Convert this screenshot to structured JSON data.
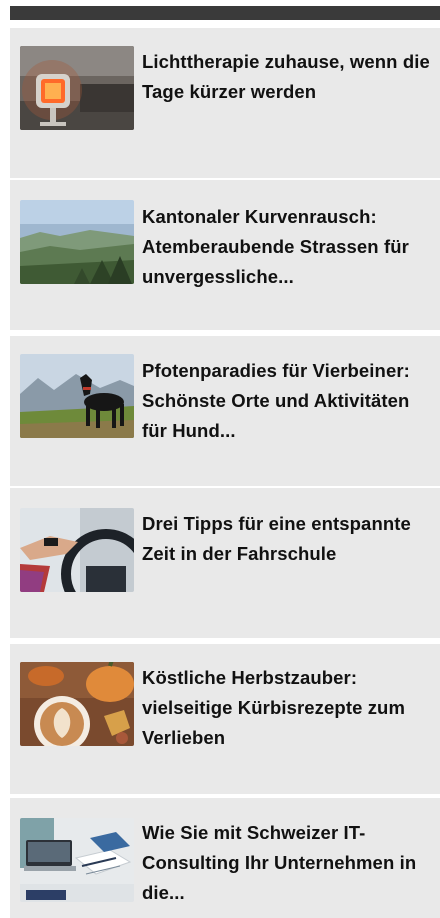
{
  "articles": [
    {
      "title": "Lichttherapie zuhause, wenn die Tage kürzer werden",
      "image": "infrared-lamp-photo"
    },
    {
      "title": "Kantonaler Kurvenrausch: Atemberaubende Strassen für unvergessliche...",
      "image": "alpine-valley-photo"
    },
    {
      "title": "Pfotenparadies für Vierbeiner: Schönste Orte und Aktivitäten für Hund...",
      "image": "dog-in-mountains-photo"
    },
    {
      "title": "Drei Tipps für eine entspannte Zeit in der Fahrschule",
      "image": "hands-on-steering-wheel-photo"
    },
    {
      "title": "Köstliche Herbstzauber: vielseitige Kürbisrezepte zum Verlieben",
      "image": "pumpkins-and-latte-photo"
    },
    {
      "title": "Wie Sie mit Schweizer IT-Consulting Ihr Unternehmen in die...",
      "image": "laptop-desk-photo"
    }
  ]
}
